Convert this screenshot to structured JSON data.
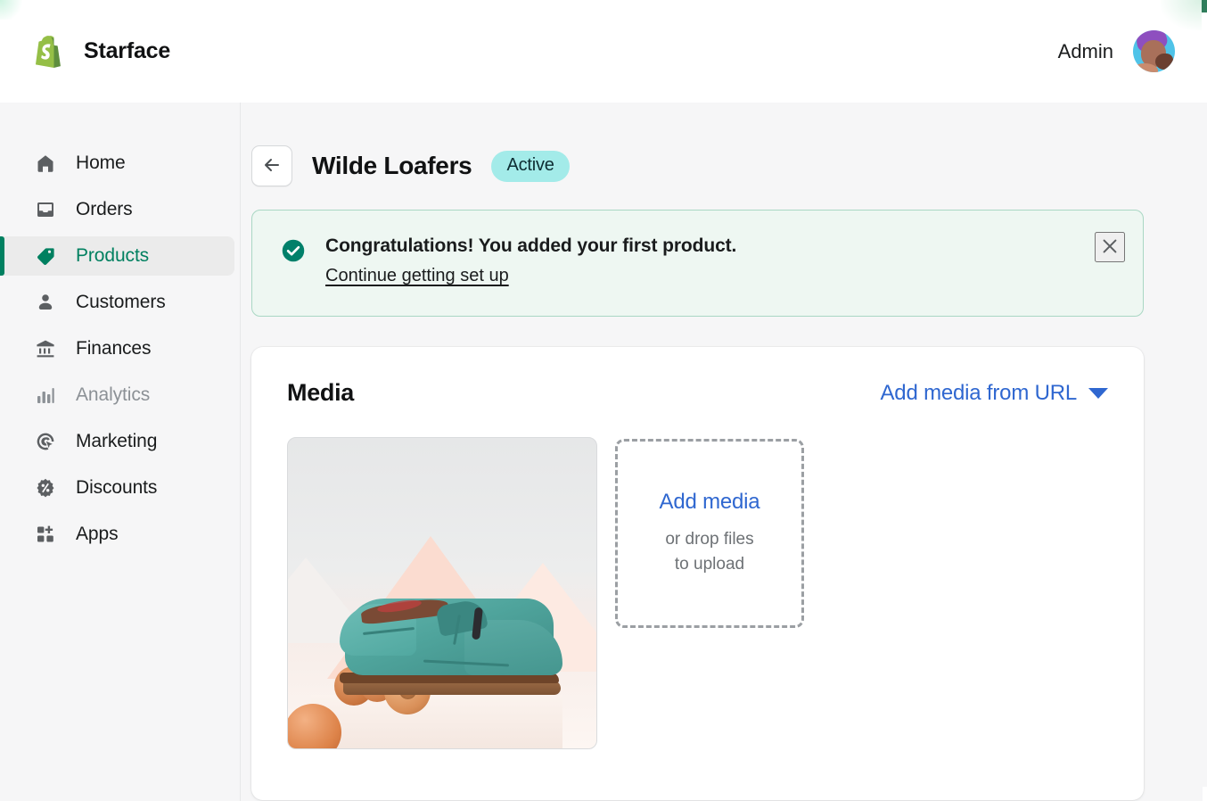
{
  "topbar": {
    "brand": "Starface",
    "logo_icon": "shopify-bag-icon",
    "admin_label": "Admin",
    "avatar_icon": "user-avatar"
  },
  "sidebar": {
    "items": [
      {
        "label": "Home",
        "icon": "home-icon",
        "active": false,
        "dimmed": false
      },
      {
        "label": "Orders",
        "icon": "orders-icon",
        "active": false,
        "dimmed": false
      },
      {
        "label": "Products",
        "icon": "tag-icon",
        "active": true,
        "dimmed": false
      },
      {
        "label": "Customers",
        "icon": "person-icon",
        "active": false,
        "dimmed": false
      },
      {
        "label": "Finances",
        "icon": "bank-icon",
        "active": false,
        "dimmed": false
      },
      {
        "label": "Analytics",
        "icon": "bar-chart-icon",
        "active": false,
        "dimmed": true
      },
      {
        "label": "Marketing",
        "icon": "target-icon",
        "active": false,
        "dimmed": false
      },
      {
        "label": "Discounts",
        "icon": "discount-icon",
        "active": false,
        "dimmed": false
      },
      {
        "label": "Apps",
        "icon": "apps-icon",
        "active": false,
        "dimmed": false
      }
    ]
  },
  "page": {
    "back_icon": "arrow-left-icon",
    "title": "Wilde Loafers",
    "status": "Active"
  },
  "banner": {
    "icon": "success-check-icon",
    "title": "Congratulations! You added your first product.",
    "link": "Continue getting set up",
    "close_icon": "close-icon"
  },
  "media": {
    "title": "Media",
    "url_action": "Add media from URL",
    "url_caret_icon": "chevron-down-icon",
    "thumbnail_alt": "Teal brogue loafer on wooden spheres",
    "dropzone": {
      "action": "Add media",
      "hint": "or drop files\nto upload"
    }
  },
  "colors": {
    "brand_green": "#008060",
    "link_blue": "#2f67d0",
    "badge_cyan": "#a3ebe9",
    "banner_bg": "#eef7f2",
    "banner_border": "#a9d7c4",
    "app_bg": "#f6f6f7"
  }
}
